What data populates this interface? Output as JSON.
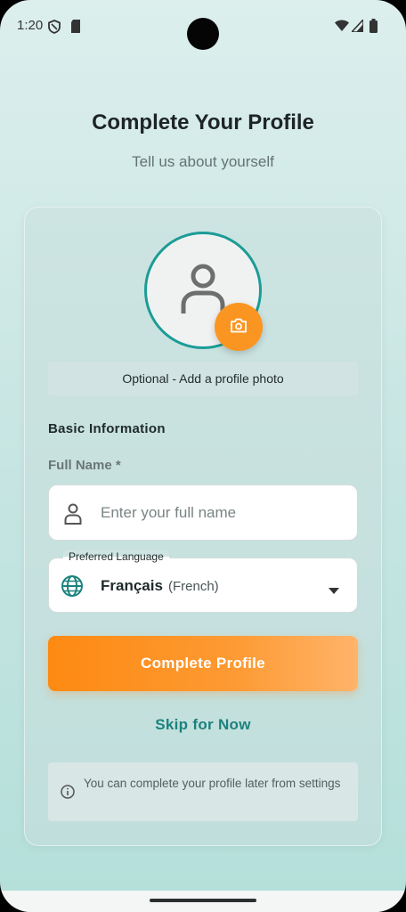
{
  "status_bar": {
    "time": "1:20"
  },
  "header": {
    "title": "Complete Your Profile",
    "subtitle": "Tell us about yourself"
  },
  "avatar": {
    "photo_hint": "Optional - Add a profile photo"
  },
  "form": {
    "section_title": "Basic Information",
    "full_name_label": "Full Name *",
    "full_name_placeholder": "Enter your full name",
    "full_name_value": "",
    "language_label": "Preferred Language",
    "language_value": "Français",
    "language_subtext": "(French)"
  },
  "actions": {
    "primary_label": "Complete Profile",
    "skip_label": "Skip for Now"
  },
  "info": {
    "text": "You can complete your profile later from settings"
  },
  "colors": {
    "accent_orange": "#fb9522",
    "teal": "#1c9c96",
    "link_teal": "#1c827e"
  },
  "icons": [
    "shield-icon",
    "sim-card-icon",
    "wifi-icon",
    "signal-icon",
    "battery-icon",
    "person-icon",
    "camera-icon",
    "globe-icon",
    "dropdown-arrow-icon",
    "info-icon"
  ]
}
